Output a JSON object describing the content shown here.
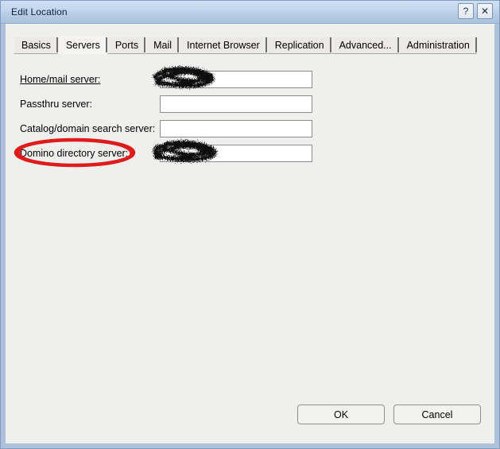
{
  "window": {
    "title": "Edit Location",
    "help_button_label": "?",
    "close_button_label": "✕"
  },
  "tabs": [
    {
      "label": "Basics",
      "active": false
    },
    {
      "label": "Servers",
      "active": true
    },
    {
      "label": "Ports",
      "active": false
    },
    {
      "label": "Mail",
      "active": false
    },
    {
      "label": "Internet Browser",
      "active": false
    },
    {
      "label": "Replication",
      "active": false
    },
    {
      "label": "Advanced...",
      "active": false
    },
    {
      "label": "Administration",
      "active": false
    }
  ],
  "form": {
    "rows": [
      {
        "label": "Home/mail server:",
        "value": "",
        "placeholder": "",
        "is_link": true,
        "redacted": true
      },
      {
        "label": "Passthru server:",
        "value": "",
        "placeholder": "",
        "is_link": false,
        "redacted": false
      },
      {
        "label": "Catalog/domain search server:",
        "value": "",
        "placeholder": "",
        "is_link": false,
        "redacted": false
      },
      {
        "label": "Domino directory server:",
        "value": "",
        "placeholder": "",
        "is_link": false,
        "redacted": true
      }
    ]
  },
  "annotation": {
    "type": "ellipse-highlight",
    "color": "#e01b1b",
    "targets": "Domino directory server:"
  },
  "footer": {
    "ok_label": "OK",
    "cancel_label": "Cancel"
  },
  "colors": {
    "titlebar_top": "#cfe0f2",
    "titlebar_bottom": "#a9c2de",
    "window_frame": "#aec0da",
    "dialog_background": "#eff0ee",
    "annotation_red": "#e01b1b",
    "redaction_black": "#111111"
  }
}
